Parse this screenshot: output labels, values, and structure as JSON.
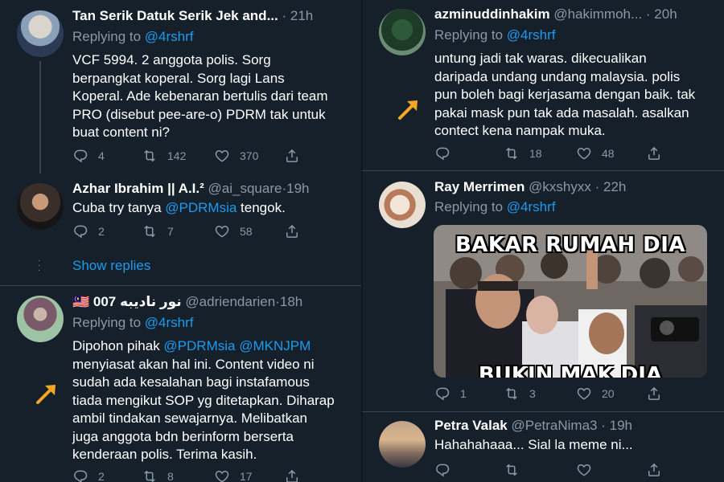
{
  "colors": {
    "background": "#15202b",
    "text": "#ffffff",
    "muted": "#8899a6",
    "link": "#1d9bf0",
    "line": "#38444d",
    "arrow": "#f5a623"
  },
  "left": {
    "tweets": [
      {
        "name": "Tan Serik Datuk Serik Jek and...",
        "handle": "",
        "time": "21h",
        "replying_prefix": "Replying to ",
        "replying_to": "@4rshrf",
        "body": [
          "VCF 5994. 2 anggota polis. Sorg",
          "berpangkat koperal. Sorg lagi Lans",
          "Koperal. Ade kebenaran bertulis dari team",
          "PRO (disebut pee-are-o) PDRM tak untuk",
          "buat content ni?"
        ],
        "replies": "4",
        "retweets": "142",
        "likes": "370"
      },
      {
        "name": "Azhar Ibrahim || A.I.²",
        "handle": "@ai_square",
        "time": "19h",
        "body_pre": "Cuba try tanya ",
        "body_link": "@PDRMsia",
        "body_post": " tengok.",
        "replies": "2",
        "retweets": "7",
        "likes": "58"
      },
      {
        "name": "🇲🇾 نور ناديبه 007",
        "handle": "@adriendarien",
        "time": "18h",
        "replying_prefix": "Replying to ",
        "replying_to": "@4rshrf",
        "body_line1_pre": "Dipohon pihak ",
        "body_line1_link1": "@PDRMsia",
        "body_line1_link2": "@MKNJPM",
        "body": [
          "menyiasat akan hal ini. Content video ni",
          "sudah ada kesalahan bagi instafamous",
          "tiada mengikut SOP yg ditetapkan. Diharap",
          "ambil tindakan sewajarnya. Melibatkan",
          "juga anggota bdn berinform berserta",
          "kenderaan polis. Terima kasih."
        ],
        "replies": "2",
        "retweets": "8",
        "likes": "17"
      }
    ],
    "show_replies": "Show replies"
  },
  "right": {
    "tweets": [
      {
        "name": "azminuddinhakim",
        "handle": "@hakimmoh...",
        "time": "20h",
        "replying_prefix": "Replying to ",
        "replying_to": "@4rshrf",
        "body": [
          "untung jadi tak waras. dikecualikan",
          "daripada undang undang malaysia. polis",
          "pun boleh bagi kerjasama dengan baik. tak",
          "pakai mask pun tak ada masalah. asalkan",
          "contect kena nampak muka."
        ],
        "replies": "",
        "retweets": "18",
        "likes": "48"
      },
      {
        "name": "Ray Merrimen",
        "handle": "@kxshyxx",
        "time": "22h",
        "replying_prefix": "Replying to ",
        "replying_to": "@4rshrf",
        "meme_top": "BAKAR RUMAH DIA",
        "meme_bottom": "BUKIN MAK DIA",
        "replies": "1",
        "retweets": "3",
        "likes": "20"
      },
      {
        "name": "Petra Valak",
        "handle": "@PetraNima3",
        "time": "19h",
        "body": "Hahahahaaa... Sial la meme ni...",
        "replies": "",
        "retweets": "",
        "likes": ""
      }
    ]
  },
  "icons": {
    "reply": "reply-icon",
    "retweet": "retweet-icon",
    "like": "heart-icon",
    "share": "share-icon",
    "arrow": "arrow-pointer-icon"
  }
}
